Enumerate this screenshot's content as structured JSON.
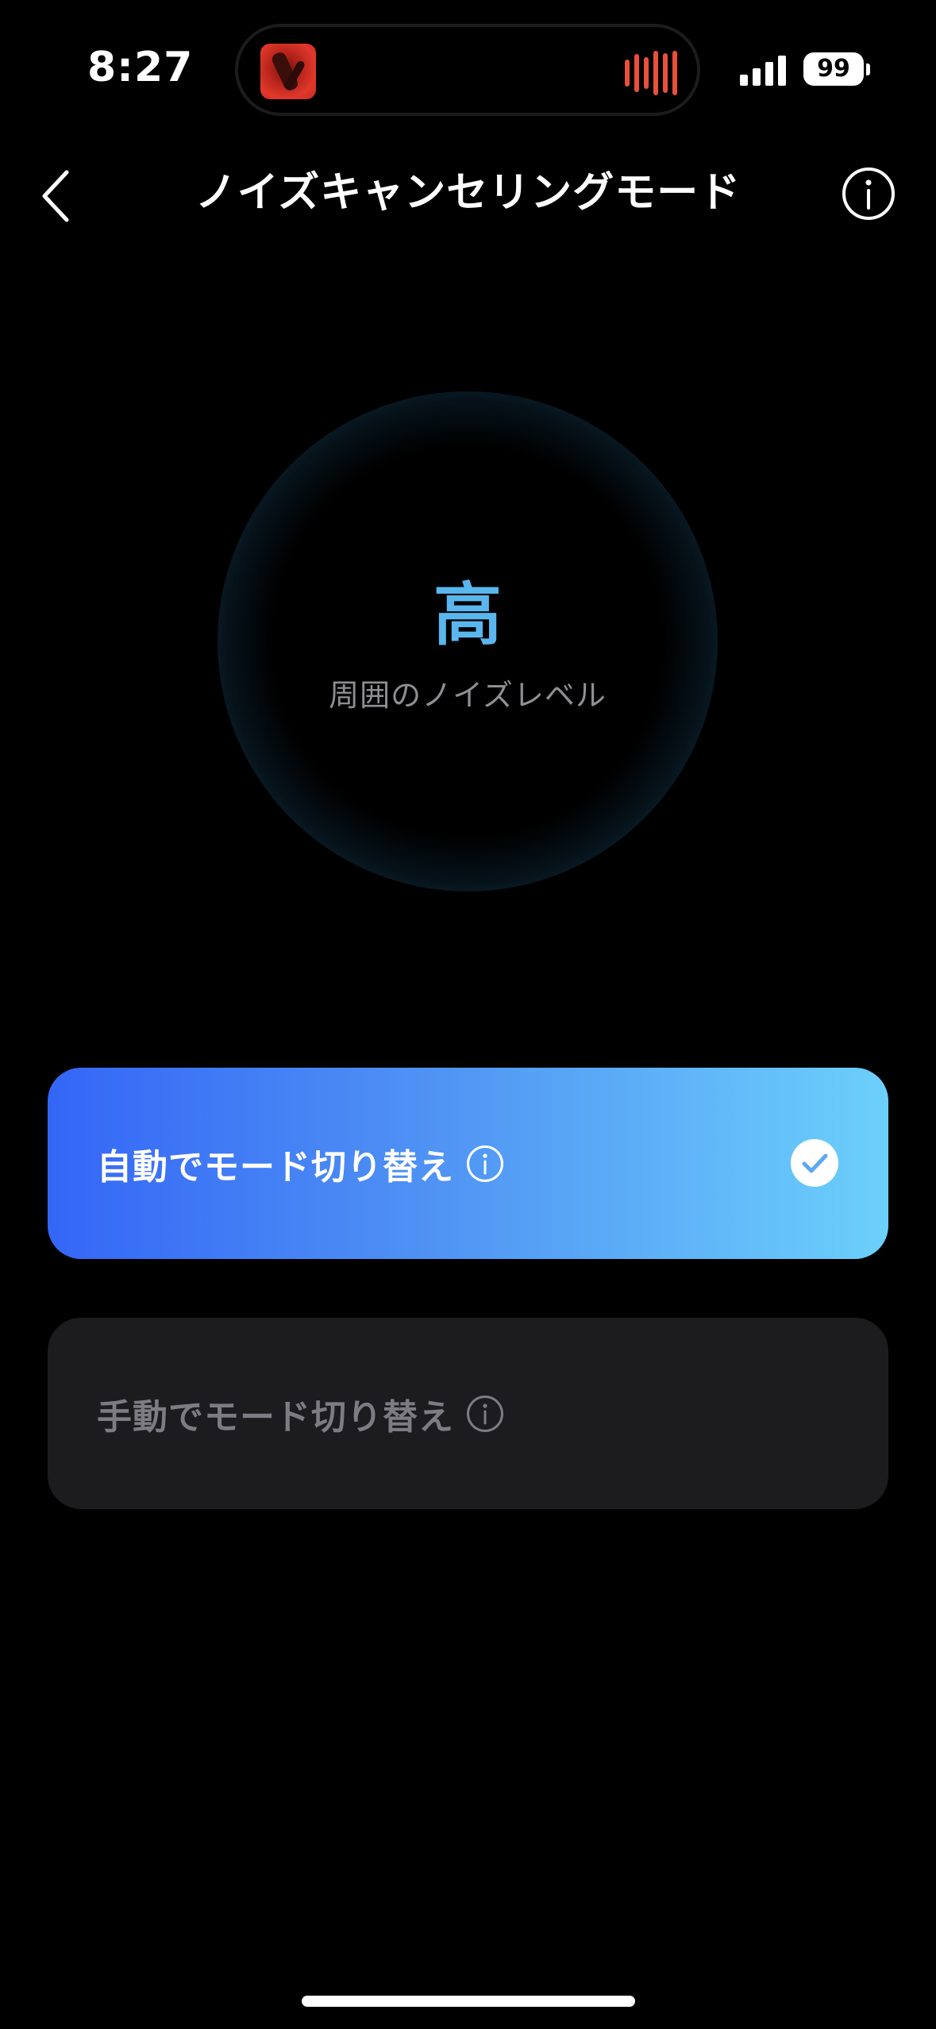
{
  "status_bar": {
    "time": "8:27",
    "battery": "99",
    "now_playing_icon": "album-art",
    "waveform_icon": "audio-waveform-icon"
  },
  "nav": {
    "title": "ノイズキャンセリングモード",
    "back_icon": "chevron-left-icon",
    "info_icon": "info-icon"
  },
  "noise": {
    "level": "高",
    "caption": "周囲のノイズレベル",
    "accent_color": "#5ab7ee"
  },
  "modes": [
    {
      "label": "自動でモード切り替え",
      "selected": true
    },
    {
      "label": "手動でモード切り替え",
      "selected": false
    }
  ],
  "colors": {
    "selected_gradient_start": "#3466f6",
    "selected_gradient_end": "#6cd0fb",
    "card_background": "#1c1c1e",
    "waveform": "#e8503c"
  }
}
